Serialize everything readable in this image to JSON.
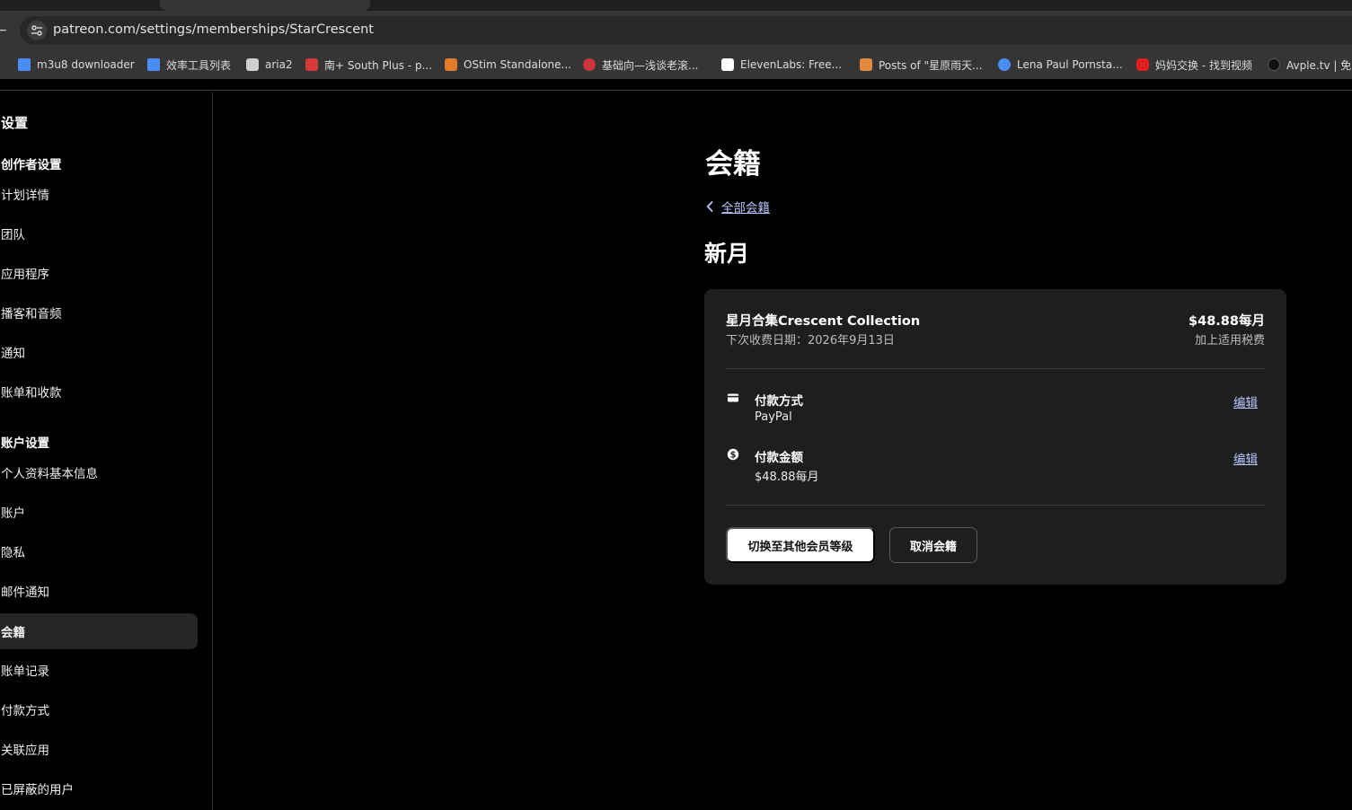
{
  "browser": {
    "url": "patreon.com/settings/memberships/StarCrescent",
    "back_fragment": "←",
    "bookmarks": [
      {
        "label": "m3u8 downloader",
        "icon": "rocket-icon",
        "color": "#4b8df8"
      },
      {
        "label": "效率工具列表",
        "icon": "rocket-icon",
        "color": "#4b8df8"
      },
      {
        "label": "aria2",
        "icon": "aria2-icon",
        "color": "#cfcfcf"
      },
      {
        "label": "南+ South Plus - p...",
        "icon": "southplus-icon",
        "color": "#d43a3a"
      },
      {
        "label": "OStim Standalone...",
        "icon": "ostim-icon",
        "color": "#e07b2a"
      },
      {
        "label": "基础向—浅谈老滚...",
        "icon": "ball-icon",
        "color": "#c8343a"
      },
      {
        "label": "ElevenLabs: Free...",
        "icon": "elevenlabs-icon",
        "color": "#ffffff"
      },
      {
        "label": "Posts of \"星原雨天...",
        "icon": "fox-icon",
        "color": "#e08a3a"
      },
      {
        "label": "Lena Paul Pornsta...",
        "icon": "x-circle-icon",
        "color": "#4a8ff0"
      },
      {
        "label": "妈妈交换 - 找到视频",
        "icon": "play-icon",
        "color": "#e02020"
      },
      {
        "label": "Avple.tv | 免费",
        "icon": "apple-icon",
        "color": "#111111"
      }
    ]
  },
  "sidebar": {
    "title": "设置",
    "creator_group": "创作者设置",
    "creator_items": [
      "计划详情",
      "团队",
      "应用程序",
      "播客和音频",
      "通知",
      "账单和收款"
    ],
    "account_group": "账户设置",
    "account_items": [
      "个人资料基本信息",
      "账户",
      "隐私",
      "邮件通知",
      "会籍",
      "账单记录",
      "付款方式",
      "关联应用",
      "已屏蔽的用户"
    ],
    "active_item": "会籍"
  },
  "main": {
    "title": "会籍",
    "back_label": "全部会籍",
    "tier_heading": "新月",
    "card": {
      "plan_name": "星月合集Crescent Collection",
      "next_billing": "下次收费日期：2026年9月13日",
      "price": "$48.88每月",
      "tax_note": "加上适用税费",
      "payment_method_label": "付款方式",
      "payment_method_value": "PayPal",
      "payment_amount_label": "付款金额",
      "payment_amount_value": "$48.88每月",
      "edit_label": "编辑",
      "switch_button": "切换至其他会员等级",
      "cancel_button": "取消会籍"
    }
  },
  "colors": {
    "accent_link": "#b9c7ff",
    "card_bg": "#1e1e1e",
    "active_nav_bg": "#262626"
  }
}
